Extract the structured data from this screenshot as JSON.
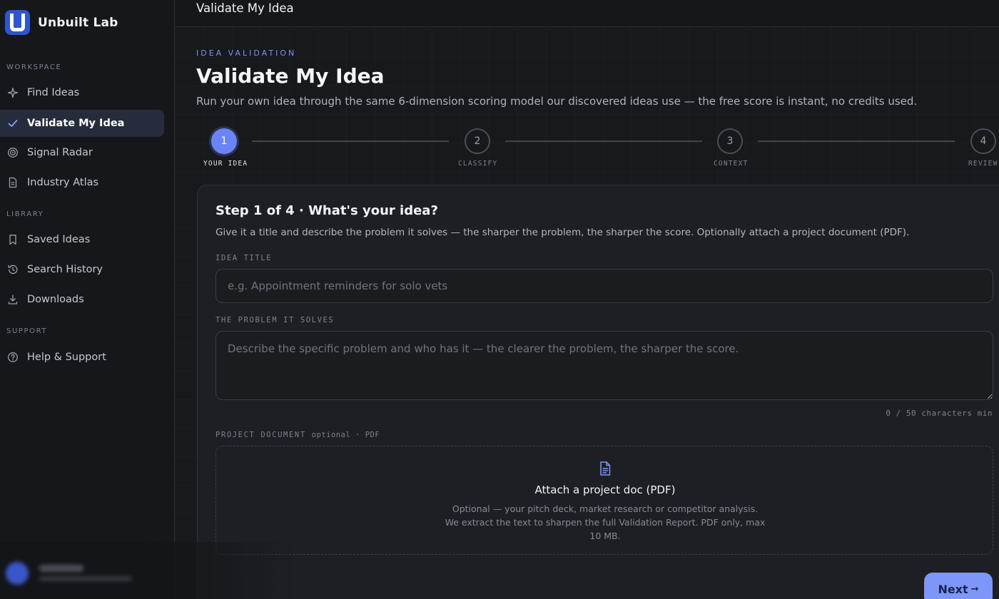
{
  "brand": {
    "name": "Unbuilt Lab"
  },
  "sidebar": {
    "sections": [
      {
        "label": "WORKSPACE"
      },
      {
        "label": "LIBRARY"
      },
      {
        "label": "SUPPORT"
      }
    ],
    "items": [
      {
        "label": "Find Ideas",
        "icon": "sparkle-icon"
      },
      {
        "label": "Validate My Idea",
        "icon": "check-icon",
        "active": true
      },
      {
        "label": "Signal Radar",
        "icon": "radar-icon"
      },
      {
        "label": "Industry Atlas",
        "icon": "document-icon"
      },
      {
        "label": "Saved Ideas",
        "icon": "bookmark-icon"
      },
      {
        "label": "Search History",
        "icon": "history-icon"
      },
      {
        "label": "Downloads",
        "icon": "download-icon"
      },
      {
        "label": "Help & Support",
        "icon": "help-icon"
      }
    ]
  },
  "topbar": {
    "title": "Validate My Idea"
  },
  "page": {
    "eyebrow": "IDEA VALIDATION",
    "title": "Validate My Idea",
    "subtitle": "Run your own idea through the same 6-dimension scoring model our discovered ideas use — the free score is instant, no credits used."
  },
  "stepper": {
    "steps": [
      {
        "number": "1",
        "label": "YOUR IDEA",
        "active": true
      },
      {
        "number": "2",
        "label": "CLASSIFY"
      },
      {
        "number": "3",
        "label": "CONTEXT"
      },
      {
        "number": "4",
        "label": "REVIEW"
      }
    ]
  },
  "form": {
    "title": "Step 1 of 4 · What's your idea?",
    "subtitle": "Give it a title and describe the problem it solves — the sharper the problem, the sharper the score. Optionally attach a project document (PDF).",
    "idea_title": {
      "label": "IDEA TITLE",
      "value": "",
      "placeholder": "e.g. Appointment reminders for solo vets"
    },
    "problem": {
      "label": "THE PROBLEM IT SOLVES",
      "value": "",
      "placeholder": "Describe the specific problem and who has it — the clearer the problem, the sharper the score.",
      "counter": "0 / 50 characters min"
    },
    "document": {
      "label": "PROJECT DOCUMENT",
      "label_suffix": "optional · PDF",
      "icon": "file-icon",
      "title": "Attach a project doc (PDF)",
      "description": "Optional — your pitch deck, market research or competitor analysis. We extract the text to sharpen the full Validation Report. PDF only, max 10 MB."
    },
    "next_label": "Next",
    "next_arrow": "→"
  },
  "colors": {
    "accent": "#6b84f5",
    "button": "#7e96f7",
    "background": "#17191d",
    "card": "#1d1f24"
  }
}
